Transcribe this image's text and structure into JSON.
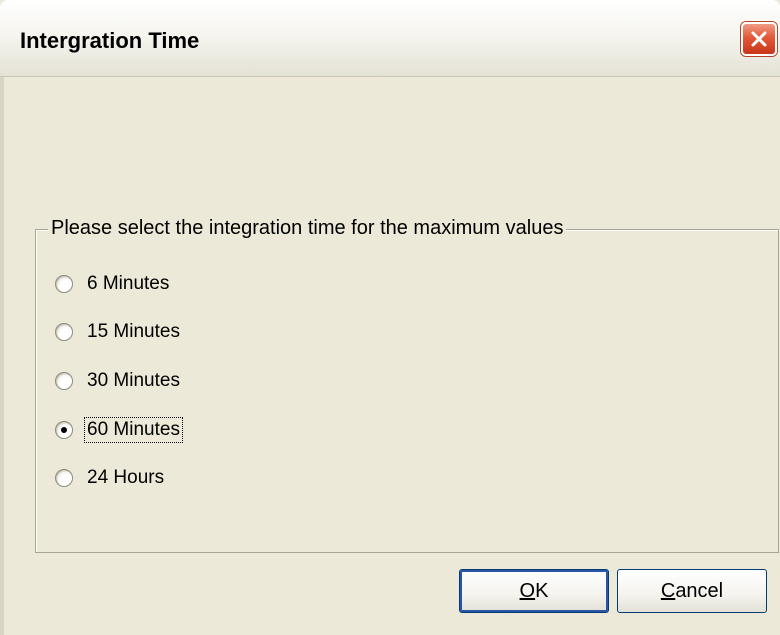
{
  "window": {
    "title": "Intergration Time",
    "close_icon": "close-icon"
  },
  "group": {
    "legend": "Please select the integration time for the maximum values",
    "options": [
      {
        "label": "6 Minutes",
        "selected": false
      },
      {
        "label": "15 Minutes",
        "selected": false
      },
      {
        "label": "30 Minutes",
        "selected": false
      },
      {
        "label": "60 Minutes",
        "selected": true
      },
      {
        "label": "24 Hours",
        "selected": false
      }
    ]
  },
  "buttons": {
    "ok_mnemonic": "O",
    "ok_rest": "K",
    "cancel_mnemonic": "C",
    "cancel_rest": "ancel"
  },
  "colors": {
    "dialog_bg": "#ece9d8",
    "close_red": "#e2583a",
    "default_button_border": "#2b56a8"
  }
}
